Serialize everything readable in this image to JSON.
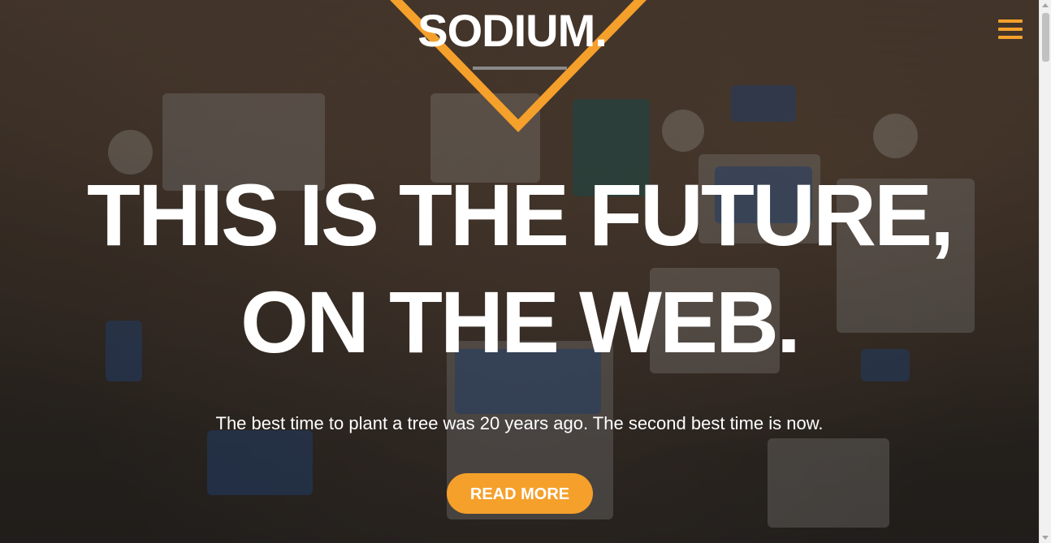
{
  "brand": {
    "logo_text": "SODIUM.",
    "accent_color": "#f5a02b"
  },
  "nav": {
    "menu_icon": "hamburger-menu-icon"
  },
  "hero": {
    "headline_line1": "THIS IS THE FUTURE,",
    "headline_line2": "ON THE WEB.",
    "tagline": "The best time to plant a tree was 20 years ago. The second best time is now.",
    "cta_label": "READ MORE"
  }
}
